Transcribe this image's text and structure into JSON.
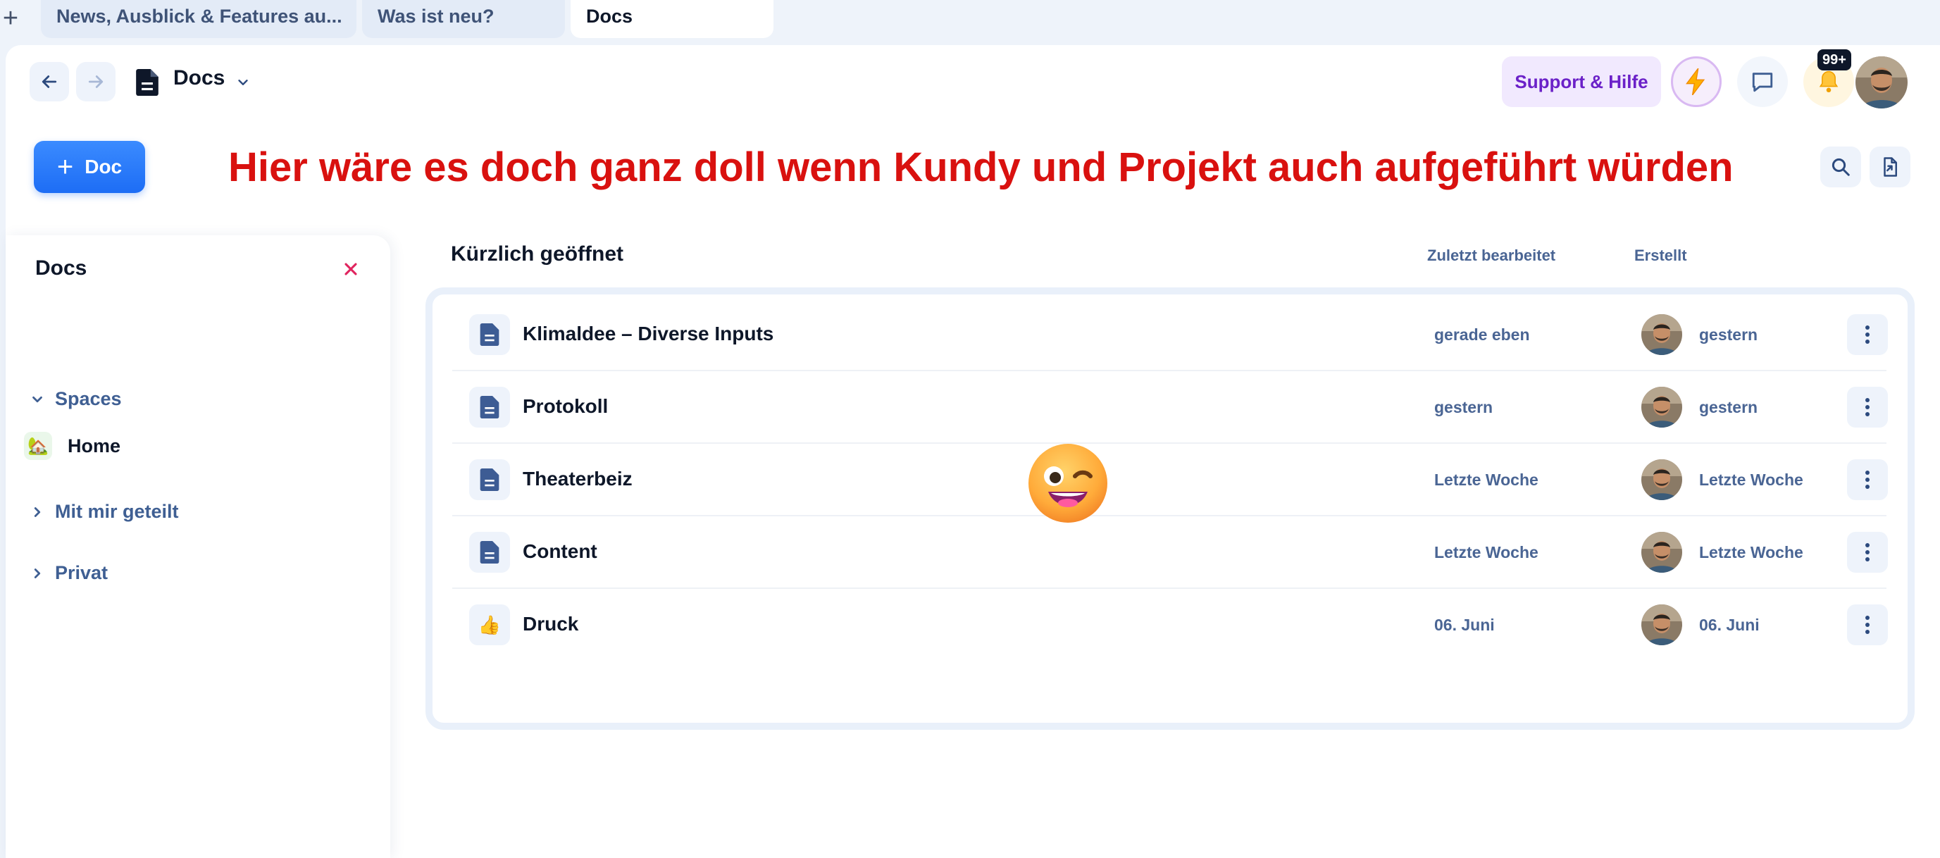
{
  "browser_tabs": [
    {
      "label": "News, Ausblick & Features au...",
      "active": false
    },
    {
      "label": "Was ist neu?",
      "active": false
    },
    {
      "label": "Docs",
      "active": true
    }
  ],
  "header": {
    "breadcrumb_icon": "document-icon",
    "breadcrumb_title": "Docs",
    "support_label": "Support & Hilfe",
    "notification_badge": "99+",
    "accent_color": "#1d6df5",
    "support_color": "#6b21c8"
  },
  "toolbar": {
    "new_doc_label": "Doc"
  },
  "annotation": {
    "text": "Hier wäre es doch ganz doll wenn Kundy und Projekt auch aufgeführt würden",
    "color": "#d9110f"
  },
  "sidebar": {
    "title": "Docs",
    "sections": [
      {
        "label": "Spaces",
        "expanded": true,
        "items": [
          {
            "label": "Home",
            "icon": "house-plant-icon"
          }
        ]
      },
      {
        "label": "Mit mir geteilt",
        "expanded": false
      },
      {
        "label": "Privat",
        "expanded": false
      }
    ]
  },
  "recent": {
    "title": "Kürzlich geöffnet",
    "columns": {
      "edited": "Zuletzt bearbeitet",
      "created": "Erstellt"
    },
    "rows": [
      {
        "name": "Klimaldee – Diverse Inputs",
        "icon": "document-icon",
        "edited": "gerade eben",
        "created": "gestern"
      },
      {
        "name": "Protokoll",
        "icon": "document-icon",
        "edited": "gestern",
        "created": "gestern"
      },
      {
        "name": "Theaterbeiz",
        "icon": "document-icon",
        "edited": "Letzte Woche",
        "created": "Letzte Woche"
      },
      {
        "name": "Content",
        "icon": "document-icon",
        "edited": "Letzte Woche",
        "created": "Letzte Woche"
      },
      {
        "name": "Druck",
        "icon": "thumbs-up-icon",
        "icon_glyph": "👍",
        "edited": "06. Juni",
        "created": "06. Juni"
      }
    ]
  }
}
